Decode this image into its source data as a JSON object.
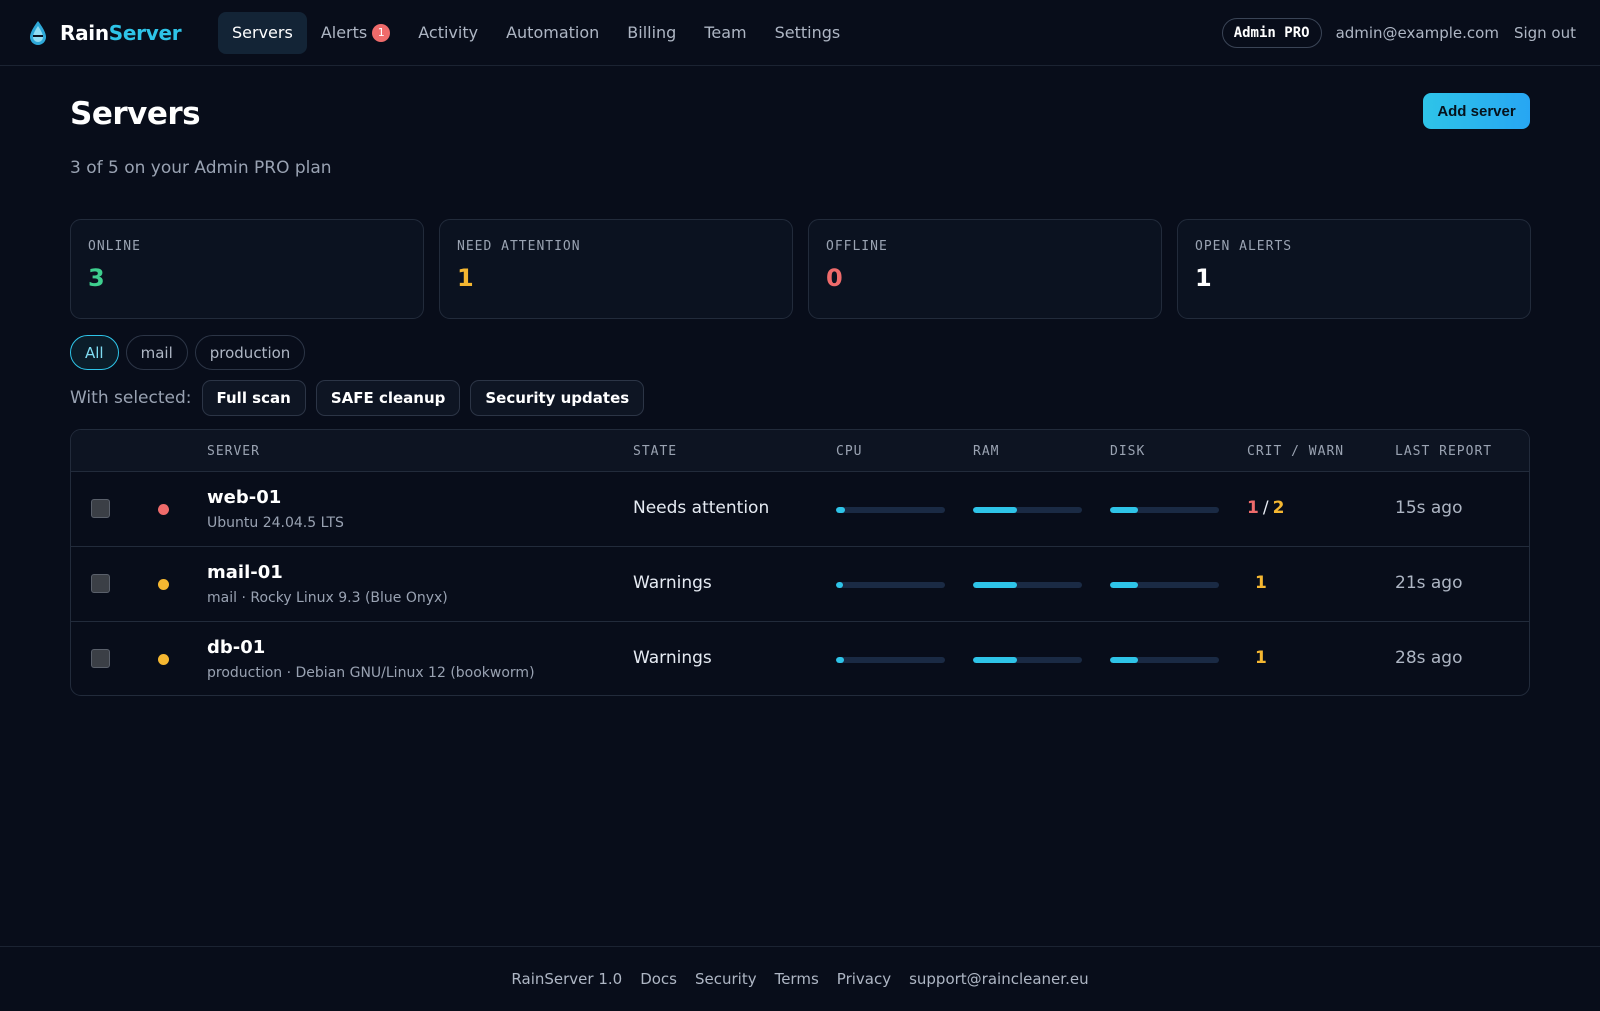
{
  "brand": {
    "name_part1": "Rain",
    "name_part2": "Server"
  },
  "nav": {
    "items": [
      {
        "label": "Servers",
        "active": true
      },
      {
        "label": "Alerts",
        "badge": "1"
      },
      {
        "label": "Activity"
      },
      {
        "label": "Automation"
      },
      {
        "label": "Billing"
      },
      {
        "label": "Team"
      },
      {
        "label": "Settings"
      }
    ]
  },
  "account": {
    "plan": "Admin PRO",
    "email": "admin@example.com",
    "sign_out": "Sign out"
  },
  "page": {
    "title": "Servers",
    "subtitle": "3 of 5 on your Admin PRO plan",
    "add_button": "Add server"
  },
  "stats": [
    {
      "label": "ONLINE",
      "value": "3",
      "color": "#3ecf8e"
    },
    {
      "label": "NEED ATTENTION",
      "value": "1",
      "color": "#f5b731"
    },
    {
      "label": "OFFLINE",
      "value": "0",
      "color": "#ef6b6b"
    },
    {
      "label": "OPEN ALERTS",
      "value": "1",
      "color": "#ffffff"
    }
  ],
  "filters": {
    "chips": [
      "All",
      "mail",
      "production"
    ],
    "selected": "All"
  },
  "bulk": {
    "label": "With selected:",
    "actions": [
      "Full scan",
      "SAFE cleanup",
      "Security updates"
    ]
  },
  "table": {
    "headers": {
      "server": "SERVER",
      "state": "STATE",
      "cpu": "CPU",
      "ram": "RAM",
      "disk": "DISK",
      "critwarn": "CRIT / WARN",
      "last": "LAST REPORT"
    },
    "rows": [
      {
        "name": "web-01",
        "meta": "Ubuntu 24.04.5 LTS",
        "state": "Needs attention",
        "status_color": "#ef6b6b",
        "cpu": 0.08,
        "ram": 0.4,
        "disk": 0.26,
        "crit": "1",
        "separator": "/",
        "warn": "2",
        "last": "15s ago"
      },
      {
        "name": "mail-01",
        "meta": "mail · Rocky Linux 9.3 (Blue Onyx)",
        "state": "Warnings",
        "status_color": "#f5b731",
        "cpu": 0.06,
        "ram": 0.4,
        "disk": 0.26,
        "crit": "",
        "separator": "",
        "warn": "1",
        "last": "21s ago"
      },
      {
        "name": "db-01",
        "meta": "production · Debian GNU/Linux 12 (bookworm)",
        "state": "Warnings",
        "status_color": "#f5b731",
        "cpu": 0.07,
        "ram": 0.4,
        "disk": 0.26,
        "crit": "",
        "separator": "",
        "warn": "1",
        "last": "28s ago"
      }
    ]
  },
  "footer": {
    "links": [
      "RainServer 1.0",
      "Docs",
      "Security",
      "Terms",
      "Privacy",
      "support@raincleaner.eu"
    ]
  },
  "icons": {
    "logo": "raindrop-icon"
  },
  "colors": {
    "accent": "#2ec4e8",
    "background": "#080d1a"
  }
}
